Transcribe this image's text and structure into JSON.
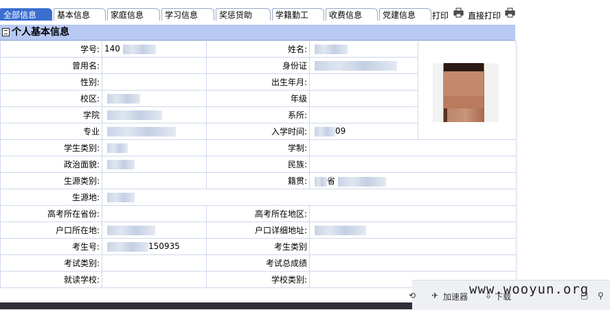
{
  "tabs": [
    "全部信息",
    "基本信息",
    "家庭信息",
    "学习信息",
    "奖惩贷助",
    "学籍勤工",
    "收费信息",
    "党建信息"
  ],
  "actions": {
    "print": "打印",
    "direct_print": "直接打印"
  },
  "section": {
    "title": "个人基本信息"
  },
  "fields": {
    "xuehao_label": "学号:",
    "xuehao_value": "140",
    "xingming_label": "姓名:",
    "cengyongming_label": "曾用名:",
    "shenfenzheng_label": "身份证",
    "xingbie_label": "性别:",
    "chushengnianyue_label": "出生年月:",
    "xiaoqu_label": "校区:",
    "nianji_label": "年级",
    "xueyuan_label": "学院",
    "xisuo_label": "系所:",
    "zhuanye_label": "专业",
    "ruxueshijian_label": "入学时间:",
    "ruxueshijian_value": "09",
    "xueshengleibie_label": "学生类别:",
    "xuezhi_label": "学制:",
    "zhengzhimianmao_label": "政治面貌:",
    "minzu_label": "民族:",
    "shengyuanleibie_label": "生源类别:",
    "jiguan_label": "籍贯:",
    "jiguan_value": "省",
    "shengyuandi_label": "生源地:",
    "gaokaoshengfen_label": "高考所在省份:",
    "gaokaodiqu_label": "高考所在地区:",
    "hukou_label": "户口所在地:",
    "hukouxiangxi_label": "户口详细地址:",
    "kaoshenghao_label": "考生号:",
    "kaoshenghao_value": "150935",
    "kaoshengleibie_label": "考生类别",
    "kaoshileibie_label": "考试类别:",
    "kaoshizongchengji_label": "考试总成绩",
    "jiuduxuexiao_label": "就读学校:",
    "xuexiaoleibie_label": "学校类别:"
  },
  "statusbar": {
    "accelerator": "加速器",
    "download": "下载"
  },
  "watermark": "www.wooyun.org"
}
